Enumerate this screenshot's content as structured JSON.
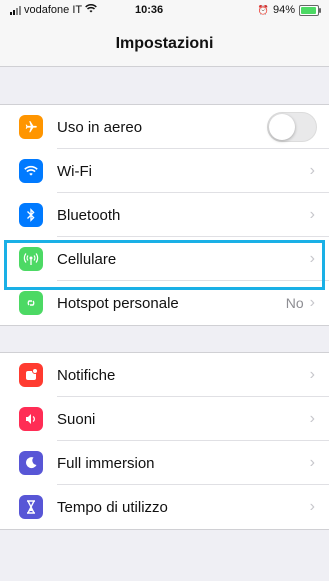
{
  "status_bar": {
    "carrier": "vodafone IT",
    "time": "10:36",
    "battery": "94%",
    "battery_level": 0.94
  },
  "nav": {
    "title": "Impostazioni"
  },
  "group1": [
    {
      "label": "Uso in aereo",
      "icon": "airplane-icon",
      "color": "#ff9500",
      "control": "toggle",
      "toggle_on": false
    },
    {
      "label": "Wi-Fi",
      "icon": "wifi-icon",
      "color": "#007aff",
      "control": "chevron"
    },
    {
      "label": "Bluetooth",
      "icon": "bluetooth-icon",
      "color": "#007aff",
      "control": "chevron"
    },
    {
      "label": "Cellulare",
      "icon": "cellular-antenna-icon",
      "color": "#4cd964",
      "control": "chevron"
    },
    {
      "label": "Hotspot personale",
      "icon": "hotspot-icon",
      "color": "#4cd964",
      "control": "chevron",
      "value": "No"
    }
  ],
  "group2": [
    {
      "label": "Notifiche",
      "icon": "notification-icon",
      "color": "#ff3b30",
      "control": "chevron"
    },
    {
      "label": "Suoni",
      "icon": "speaker-icon",
      "color": "#ff2d55",
      "control": "chevron"
    },
    {
      "label": "Full immersion",
      "icon": "moon-icon",
      "color": "#5856d6",
      "control": "chevron"
    },
    {
      "label": "Tempo di utilizzo",
      "icon": "hourglass-icon",
      "color": "#5856d6",
      "control": "chevron"
    }
  ],
  "highlight_color": "#1ab0e6"
}
